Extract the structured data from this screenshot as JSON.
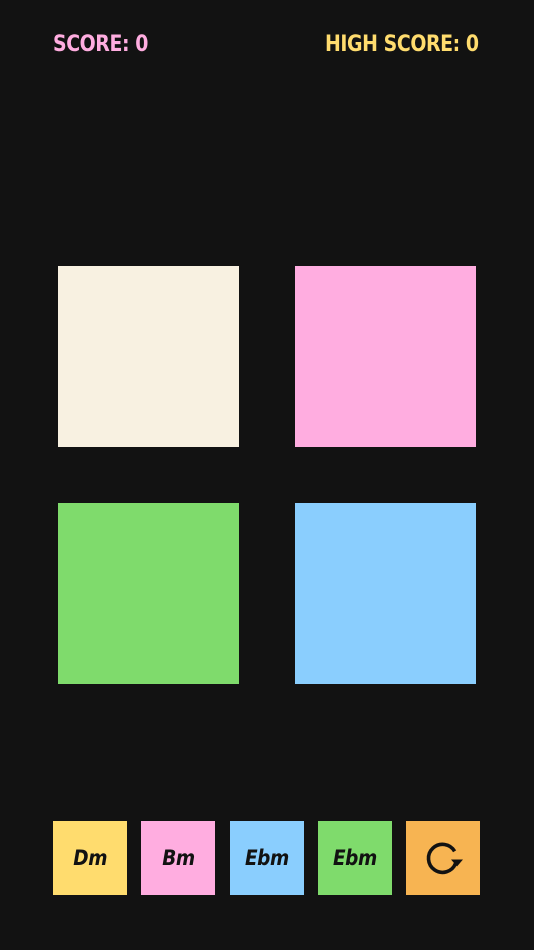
{
  "header": {
    "score_text": "SCORE: 0",
    "high_score_text": "HIGH SCORE: 0"
  },
  "pads": [
    {
      "color": "#F8F1E1"
    },
    {
      "color": "#FFADE0"
    },
    {
      "color": "#7FDB6C"
    },
    {
      "color": "#8ACEFE"
    }
  ],
  "chord_buttons": [
    {
      "label": "Dm",
      "color": "#FFDC6E"
    },
    {
      "label": "Bm",
      "color": "#FFADE0"
    },
    {
      "label": "Ebm",
      "color": "#8ACEFE"
    },
    {
      "label": "Ebm",
      "color": "#7FDB6C"
    }
  ],
  "restart_button": {
    "icon": "restart-icon",
    "color": "#F7B452"
  },
  "colors": {
    "background": "#121212",
    "score_text": "#FFADE0",
    "high_score_text": "#FFDC6E"
  }
}
